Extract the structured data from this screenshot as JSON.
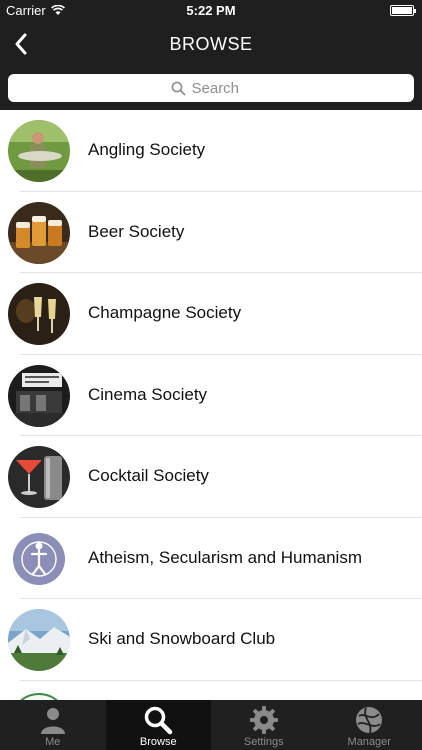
{
  "status_bar": {
    "carrier": "Carrier",
    "time": "5:22 PM"
  },
  "nav": {
    "title": "BROWSE"
  },
  "search": {
    "placeholder": "Search"
  },
  "societies": [
    {
      "label": "Angling Society",
      "thumb": "angling-photo"
    },
    {
      "label": "Beer Society",
      "thumb": "beer-photo"
    },
    {
      "label": "Champagne Society",
      "thumb": "champagne-photo"
    },
    {
      "label": "Cinema Society",
      "thumb": "cinema-photo"
    },
    {
      "label": "Cocktail Society",
      "thumb": "cocktail-photo"
    },
    {
      "label": "Atheism, Secularism and Humanism",
      "thumb": "ash-logo"
    },
    {
      "label": "Ski and Snowboard Club",
      "thumb": "ski-photo"
    }
  ],
  "tabs": [
    {
      "label": "Me",
      "icon": "person-icon"
    },
    {
      "label": "Browse",
      "icon": "search-icon"
    },
    {
      "label": "Settings",
      "icon": "gear-icon"
    },
    {
      "label": "Manager",
      "icon": "globe-icon"
    }
  ],
  "colors": {
    "bar_background": "#1f1f1f",
    "active_tab": "#111111",
    "inactive_tab_text": "#8a8a8a",
    "separator": "#e2e2e2"
  }
}
